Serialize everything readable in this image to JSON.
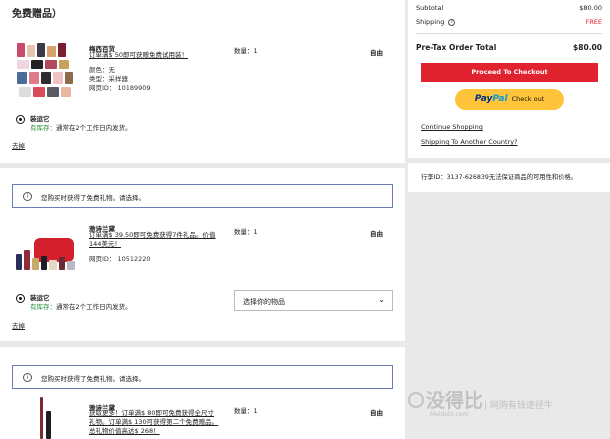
{
  "section_title": "免费赠品）",
  "items": [
    {
      "brand": "梅西百货",
      "offer": "订单满$ 50即可获赠免费试用装！",
      "color_label": "颜色：无",
      "type_label": "类型：采样器",
      "web_id": "网页ID： 10189909",
      "qty": "数量：1",
      "price": "自由",
      "ship_option": "装运它",
      "stock": "有库存：",
      "ship_text": "通常在2个工作日内发货。",
      "remove": "去掉"
    },
    {
      "notice": "您购买时获得了免费礼物。请选择。",
      "brand": "雅诗兰黛",
      "offer_l1": "订单满$ 39.50即可免费获得7件礼品。价值",
      "offer_l2": "144美元！",
      "web_id": "网页ID：  10512220",
      "qty": "数量：1",
      "price": "自由",
      "ship_option": "装运它",
      "stock": "有库存：",
      "ship_text": "通常在2个工作日内发货。",
      "remove": "去掉",
      "select": "选择你的物品"
    },
    {
      "notice": "您购买时获得了免费礼物。请选择。",
      "brand": "雅诗兰黛",
      "offer_l1": "获取更多！订单满$ 80即可免费获得全尺寸",
      "offer_l2": "礼物。订单满$ 130可获得第二个免费赠品。",
      "offer_l3": "总礼物价值高达$ 268！",
      "qty": "数量：1",
      "price": "自由"
    }
  ],
  "summary": {
    "subtotal_label": "Subtotal",
    "subtotal_value": "$80.00",
    "shipping_label": "Shipping",
    "shipping_value": "FREE",
    "pretax_label": "Pre-Tax Order Total",
    "pretax_value": "$80.00",
    "checkout_label": "Proceed To Checkout",
    "paypal_1": "Pay",
    "paypal_2": "Pal",
    "paypal_suffix": "Check out",
    "continue_label": "Continue Shopping",
    "ship_another_label": "Shipping To Another Country?"
  },
  "bag_id_text": "行李ID：3137-626839无法保证商品的可用性和价格。",
  "watermark": {
    "main": "没得比",
    "tagline": "| 网购有钱途径牛",
    "url": "Meidebi.com"
  },
  "colors": {
    "checkout_red": "#e1222f",
    "paypal_yellow": "#ffc439",
    "stock_green": "#2a8f3b",
    "free_red": "#e1222f"
  }
}
